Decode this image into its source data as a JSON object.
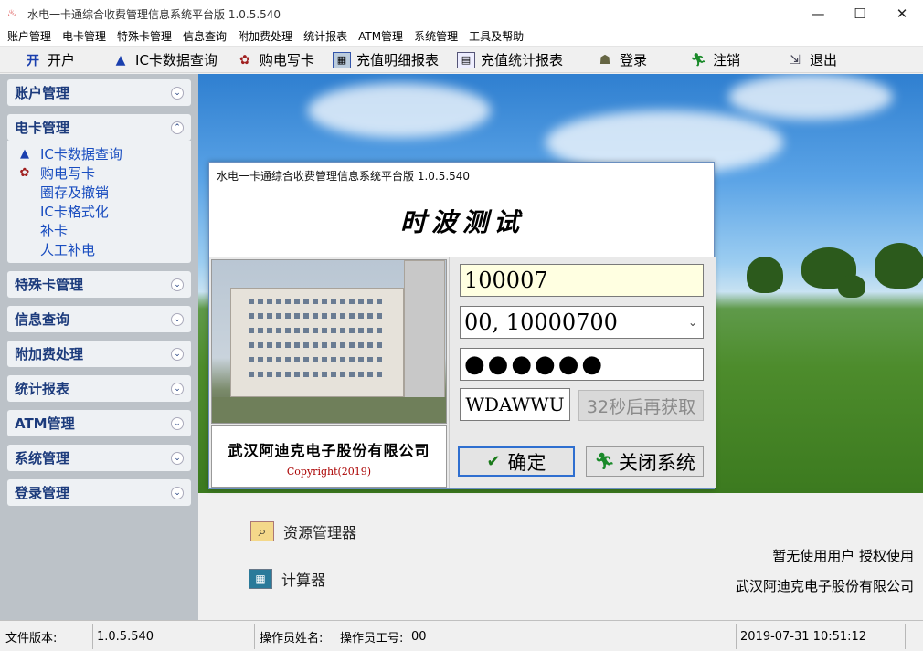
{
  "window": {
    "title": "水电一卡通综合收费管理信息系统平台版 1.0.5.540",
    "minimize": "—",
    "maximize": "☐",
    "close": "✕"
  },
  "menu": [
    "账户管理",
    "电卡管理",
    "特殊卡管理",
    "信息查询",
    "附加费处理",
    "统计报表",
    "ATM管理",
    "系统管理",
    "工具及帮助"
  ],
  "toolbar": {
    "open_account": "开户",
    "ic_query": "IC卡数据查询",
    "buy_write": "购电写卡",
    "recharge_detail": "充值明细报表",
    "recharge_stats": "充值统计报表",
    "login": "登录",
    "logout": "注销",
    "exit": "退出"
  },
  "sidebar": {
    "groups": [
      "账户管理",
      "电卡管理",
      "特殊卡管理",
      "信息查询",
      "附加费处理",
      "统计报表",
      "ATM管理",
      "系统管理",
      "登录管理"
    ],
    "electric_items": [
      "IC卡数据查询",
      "购电写卡",
      "圈存及撤销",
      "IC卡格式化",
      "补卡",
      "人工补电"
    ]
  },
  "dialog": {
    "title": "水电一卡通综合收费管理信息系统平台版 1.0.5.540",
    "heading": "时波测试",
    "company": "武汉阿迪克电子股份有限公司",
    "copyright": "Copyright(2019)",
    "user_id": "100007",
    "operator_select": "00, 10000700",
    "password_dots": "●●●●●●",
    "captcha": "WDAWWU",
    "refresh": "32秒后再获取",
    "confirm": "确定",
    "close_system": "关闭系统"
  },
  "lower": {
    "explorer": "资源管理器",
    "calculator": "计算器",
    "license": "暂无使用用户 授权使用",
    "company": "武汉阿迪克电子股份有限公司"
  },
  "status": {
    "version_label": "文件版本:",
    "version": "1.0.5.540",
    "operator_name_label": "操作员姓名:",
    "operator_id_label": "操作员工号:",
    "operator_id": "00",
    "datetime": "2019-07-31 10:51:12"
  }
}
